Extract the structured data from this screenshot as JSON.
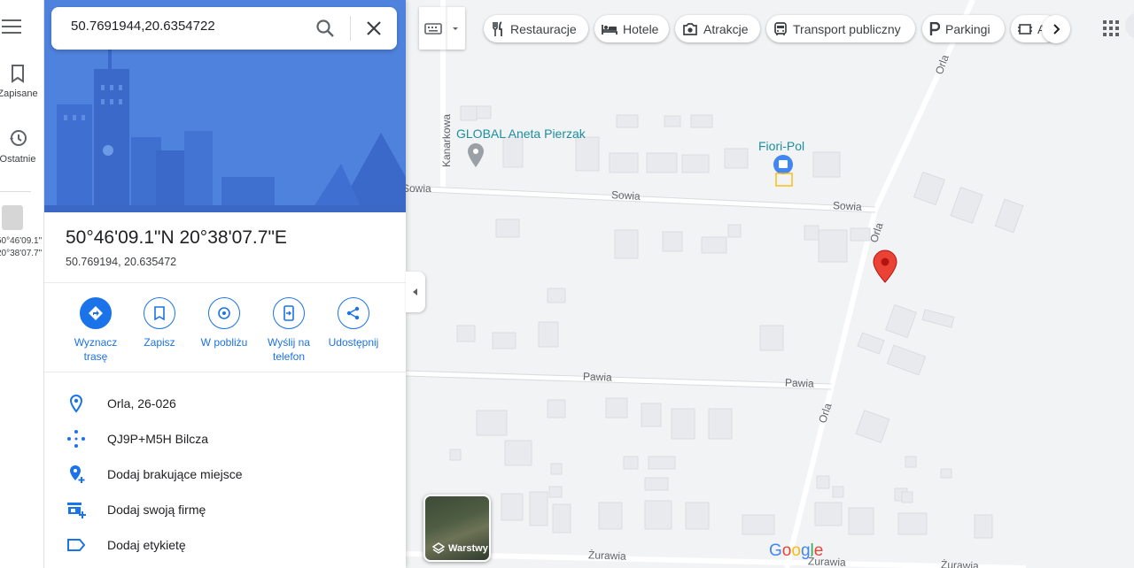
{
  "search": {
    "value": "50.7691944,20.6354722"
  },
  "rail": {
    "saved_label": "Zapisane",
    "recent_label": "Ostatnie",
    "recent_item": [
      "50°46'09.1\"",
      "20°38'07.7\""
    ]
  },
  "place": {
    "title": "50°46'09.1\"N 20°38'07.7\"E",
    "decimal": "50.769194, 20.635472"
  },
  "actions": [
    {
      "label": "Wyznacz trasę",
      "icon": "directions-icon"
    },
    {
      "label": "Zapisz",
      "icon": "bookmark-icon"
    },
    {
      "label": "W pobliżu",
      "icon": "nearby-icon"
    },
    {
      "label": "Wyślij na telefon",
      "icon": "send-to-phone-icon"
    },
    {
      "label": "Udostępnij",
      "icon": "share-icon"
    }
  ],
  "info": [
    {
      "text": "Orla, 26-026",
      "icon": "location-pin-icon"
    },
    {
      "text": "QJ9P+M5H Bilcza",
      "icon": "plus-code-icon"
    },
    {
      "text": "Dodaj brakujące miejsce",
      "icon": "add-place-icon"
    },
    {
      "text": "Dodaj swoją firmę",
      "icon": "add-business-icon"
    },
    {
      "text": "Dodaj etykietę",
      "icon": "label-icon"
    }
  ],
  "chips": [
    {
      "label": "Restauracje",
      "icon": "restaurant-icon"
    },
    {
      "label": "Hotele",
      "icon": "hotel-icon"
    },
    {
      "label": "Atrakcje",
      "icon": "camera-icon"
    },
    {
      "label": "Transport publiczny",
      "icon": "transit-icon"
    },
    {
      "label": "Parkingi",
      "icon": "parking-icon"
    },
    {
      "label": "A",
      "icon": "atm-icon"
    }
  ],
  "map": {
    "streets": [
      "Orla",
      "Kanarkowa",
      "Sowia",
      "Sowia",
      "Pawia",
      "Pawia",
      "Orla",
      "Żurawia",
      "Żurawia",
      "Żurawia",
      "Sowia"
    ],
    "pois": [
      "GLOBAL Aneta Pierzak",
      "Fiori-Pol"
    ],
    "layers_label": "Warstwy",
    "logo": "Google"
  },
  "colors": {
    "accent": "#1a73e8",
    "pin": "#ea4335",
    "poi_teal": "#1e8e9e"
  }
}
